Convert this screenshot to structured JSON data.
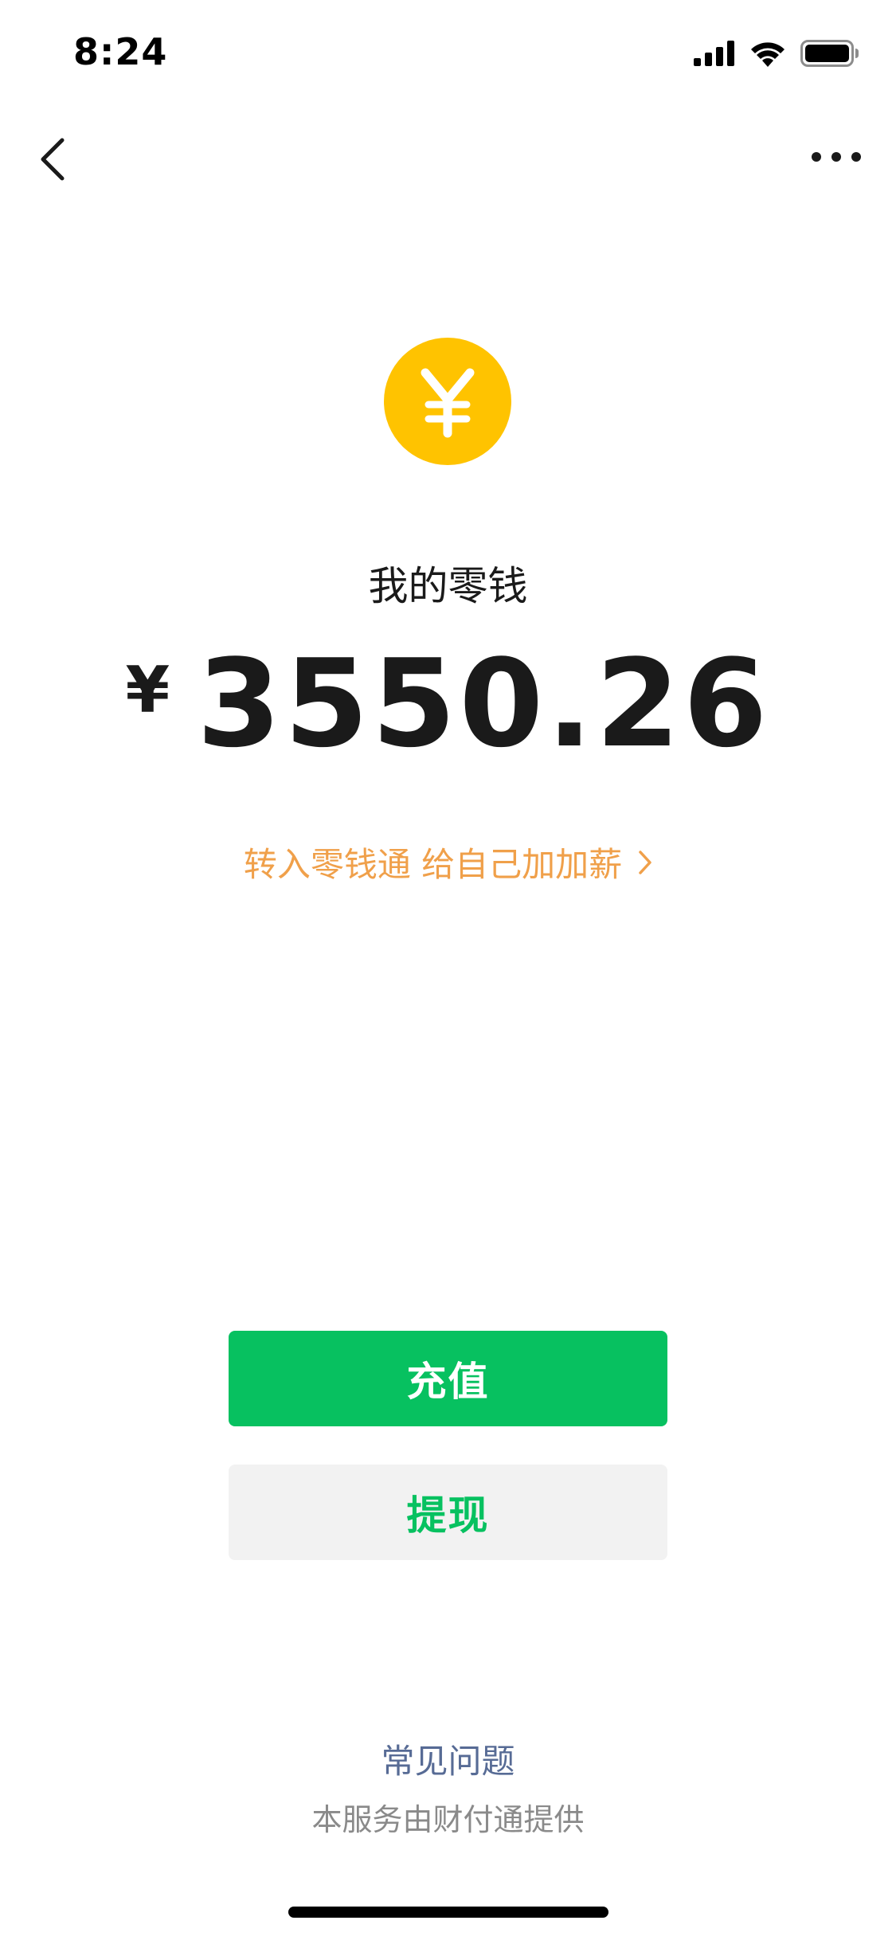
{
  "status_bar": {
    "time": "8:24",
    "icons": [
      "cellular-signal-icon",
      "wifi-icon",
      "battery-icon"
    ]
  },
  "nav": {
    "back_icon": "chevron-left-icon",
    "more_icon": "more-dots-icon"
  },
  "wallet": {
    "icon": "yuan-coin-icon",
    "title": "我的零钱",
    "currency_symbol": "¥",
    "amount": "3550.26",
    "promo_text": "转入零钱通 给自己加加薪"
  },
  "actions": {
    "topup_label": "充值",
    "withdraw_label": "提现"
  },
  "footer": {
    "faq_label": "常见问题",
    "service_note": "本服务由财付通提供"
  },
  "colors": {
    "accent_green": "#07c160",
    "coin_yellow": "#ffc300",
    "promo_orange": "#f0a04a",
    "link_blue": "#576b95"
  }
}
